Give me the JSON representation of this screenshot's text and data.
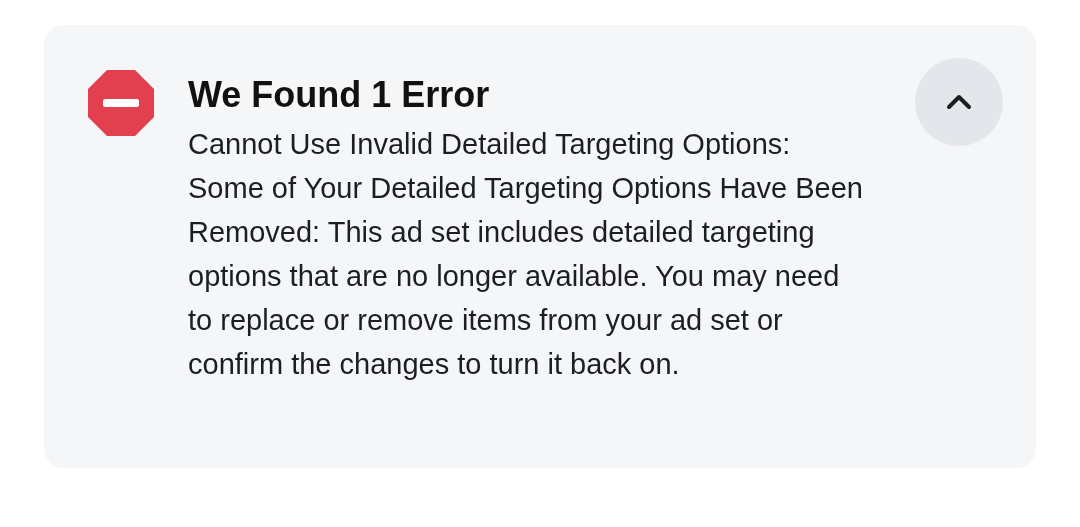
{
  "alert": {
    "kind": "error",
    "title": "We Found 1 Error",
    "message": "Cannot Use Invalid Detailed Targeting Options: Some of Your Detailed Targeting Options Have Been Removed: This ad set includes detailed targeting options that are no longer available. You may need to replace or remove items from your ad set or confirm the changes to turn it back on.",
    "expanded": true
  }
}
